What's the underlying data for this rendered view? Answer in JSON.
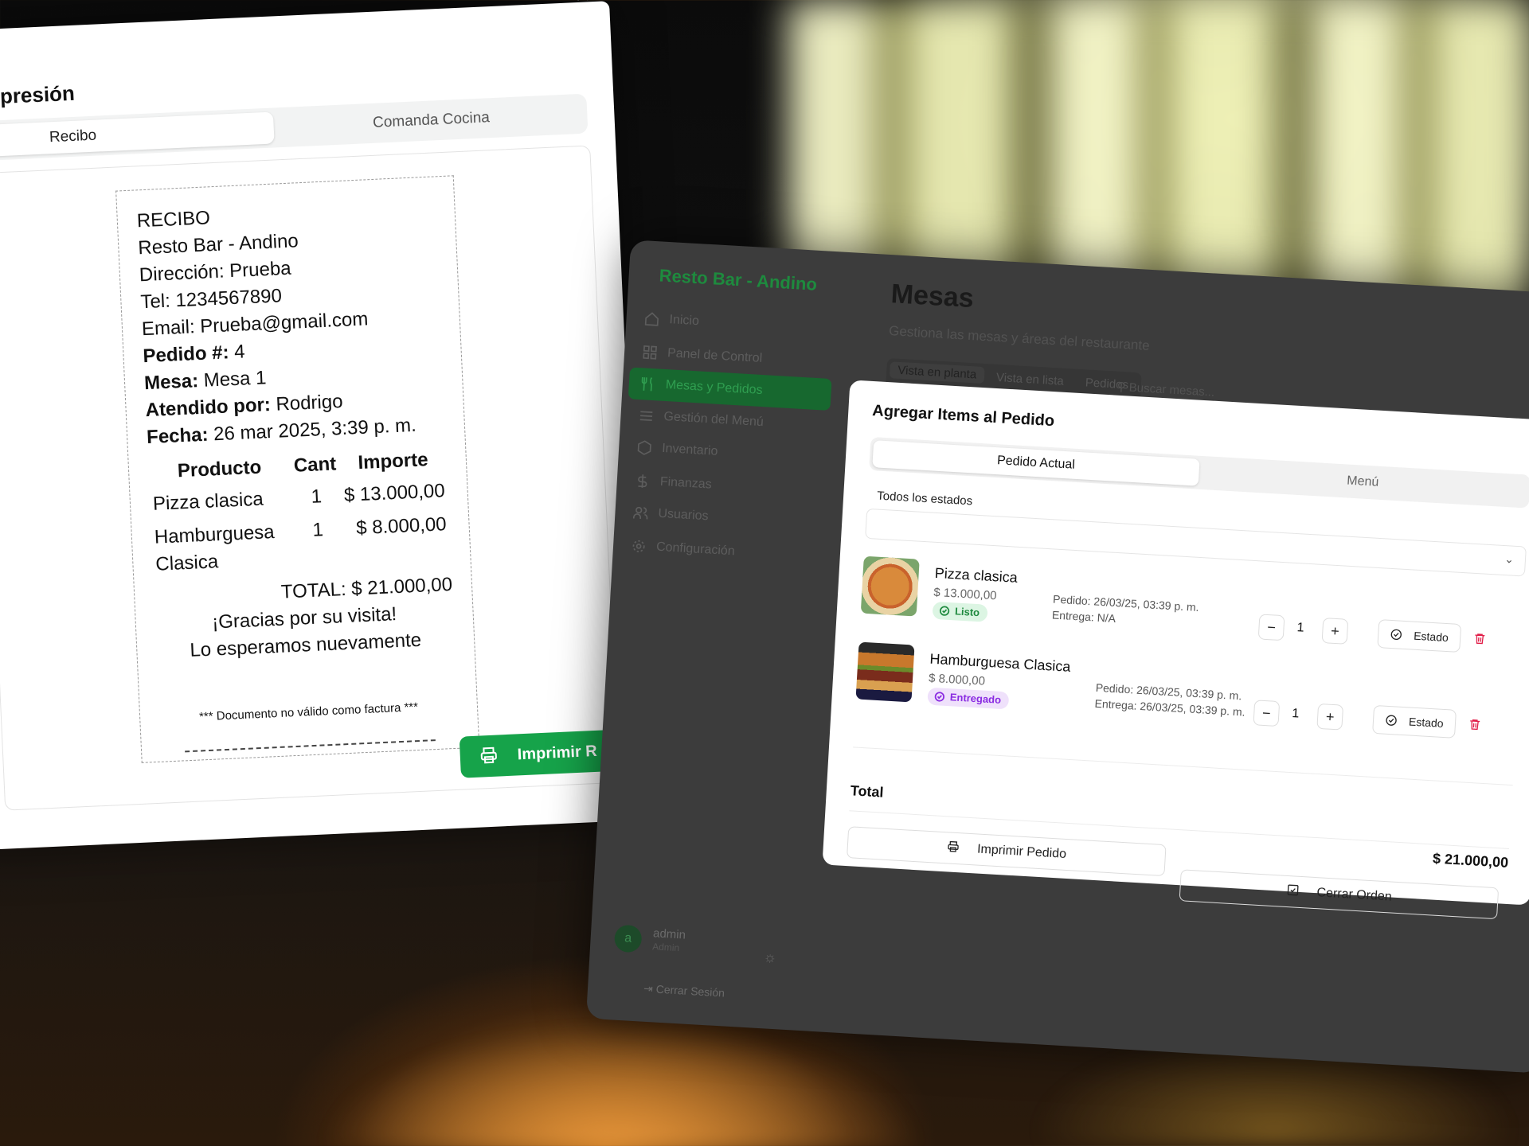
{
  "print_dialog": {
    "close": "×",
    "title": "Impresión",
    "tabs": [
      "Recibo",
      "Comanda Cocina"
    ],
    "receipt": {
      "heading": "RECIBO",
      "business": "Resto Bar - Andino",
      "address": "Dirección: Prueba",
      "phone": "Tel: 1234567890",
      "email": "Email: Prueba@gmail.com",
      "order_label": "Pedido #:",
      "order_value": "4",
      "table_label": "Mesa:",
      "table_value": "Mesa 1",
      "waiter_label": "Atendido por:",
      "waiter_value": "Rodrigo",
      "date_label": "Fecha:",
      "date_value": "26 mar 2025, 3:39 p. m.",
      "columns": [
        "Producto",
        "Cant",
        "Importe"
      ],
      "rows": [
        {
          "product": "Pizza clasica",
          "qty": "1",
          "amount": "$ 13.000,00"
        },
        {
          "product": "Hamburguesa Clasica",
          "qty": "1",
          "amount": "$ 8.000,00"
        }
      ],
      "total_label": "TOTAL:",
      "total_value": "$ 21.000,00",
      "thanks": "¡Gracias por su visita!",
      "again": "Lo esperamos nuevamente",
      "disclaimer": "*** Documento no válido como factura ***"
    },
    "print_button": "Imprimir R"
  },
  "app": {
    "brand": "Resto Bar - Andino",
    "nav": [
      {
        "label": "Inicio",
        "icon": "home-icon"
      },
      {
        "label": "Panel de Control",
        "icon": "grid-icon"
      },
      {
        "label": "Mesas y Pedidos",
        "icon": "utensils-icon",
        "active": true
      },
      {
        "label": "Gestión del Menú",
        "icon": "menu-icon"
      },
      {
        "label": "Inventario",
        "icon": "box-icon"
      },
      {
        "label": "Finanzas",
        "icon": "dollar-icon"
      },
      {
        "label": "Usuarios",
        "icon": "users-icon"
      },
      {
        "label": "Configuración",
        "icon": "gear-icon"
      }
    ],
    "user": {
      "initial": "a",
      "name": "admin",
      "role": "Admin"
    },
    "logout": "Cerrar Sesión",
    "page_title": "Mesas",
    "page_subtitle": "Gestiona las mesas y áreas del restaurante",
    "view_tabs": [
      "Vista en planta",
      "Vista en lista",
      "Pedidos"
    ],
    "search_placeholder": "Buscar mesas..."
  },
  "modal": {
    "title": "Agregar Items al Pedido",
    "close": "×",
    "tabs": [
      "Pedido Actual",
      "Menú"
    ],
    "filter": "Todos los estados",
    "items": [
      {
        "name": "Pizza clasica",
        "price": "$ 13.000,00",
        "status": "Listo",
        "status_color": "#1f8a3f",
        "ordered": "Pedido: 26/03/25, 03:39 p. m.",
        "delivered": "Entrega: N/A",
        "qty": "1"
      },
      {
        "name": "Hamburguesa Clasica",
        "price": "$ 8.000,00",
        "status": "Entregado",
        "status_color": "#8a2be2",
        "ordered": "Pedido: 26/03/25, 03:39 p. m.",
        "delivered": "Entrega: 26/03/25, 03:39 p. m.",
        "qty": "1"
      }
    ],
    "estado_label": "Estado",
    "minus": "−",
    "plus": "+",
    "total_label": "Total",
    "total_value": "$ 21.000,00",
    "print_order": "Imprimir Pedido",
    "close_order": "Cerrar Orden"
  },
  "colors": {
    "accent": "#16a34a",
    "danger": "#e11d48"
  }
}
